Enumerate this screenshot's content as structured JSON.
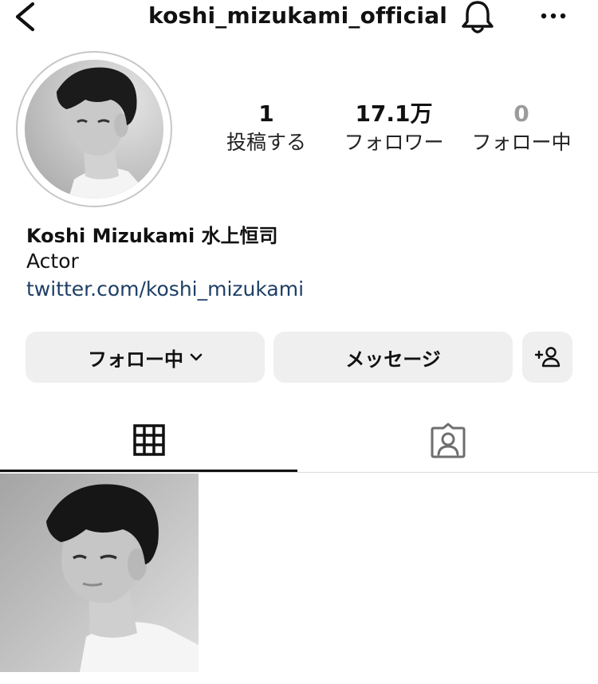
{
  "header": {
    "username": "koshi_mizukami_official",
    "back_icon": "chevron-left-icon",
    "bell_icon": "bell-icon",
    "more_icon": "more-horizontal-icon"
  },
  "profile": {
    "stats": [
      {
        "value": "1",
        "label": "投稿する"
      },
      {
        "value": "17.1万",
        "label": "フォロワー"
      },
      {
        "value": "0",
        "label": "フォロー中"
      }
    ],
    "full_name": "Koshi Mizukami 水上恒司",
    "bio": "Actor",
    "link": "twitter.com/koshi_mizukami"
  },
  "actions": {
    "follow_label": "フォロー中",
    "message_label": "メッセージ",
    "add_icon": "add-person-icon"
  },
  "tabs": {
    "grid_icon": "grid-icon",
    "tagged_icon": "tagged-person-icon",
    "active": "grid"
  },
  "colors": {
    "link": "#1e3f66",
    "button_bg": "#efefef",
    "muted": "#9b9b9b",
    "divider": "#dbdbdb"
  }
}
